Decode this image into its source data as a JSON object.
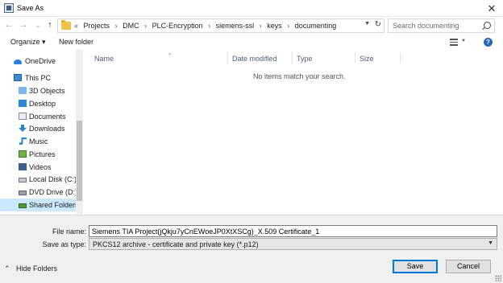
{
  "window": {
    "title": "Save As",
    "close_glyph": "✕"
  },
  "address": {
    "crumbs_prefix": "«",
    "crumbs": [
      "Projects",
      "DMC",
      "PLC-Encryption",
      "siemens-ssl",
      "keys",
      "documenting"
    ],
    "separator": "›"
  },
  "search": {
    "placeholder": "Search documenting"
  },
  "toolbar": {
    "organize_label": "Organize ▾",
    "new_folder_label": "New folder"
  },
  "nav": {
    "items": [
      {
        "label": "OneDrive",
        "icon": "onedrive-icon"
      },
      {
        "label": "This PC",
        "icon": "computer-icon"
      },
      {
        "label": "3D Objects",
        "icon": "3d-objects-icon"
      },
      {
        "label": "Desktop",
        "icon": "desktop-icon"
      },
      {
        "label": "Documents",
        "icon": "documents-icon"
      },
      {
        "label": "Downloads",
        "icon": "downloads-icon"
      },
      {
        "label": "Music",
        "icon": "music-icon"
      },
      {
        "label": "Pictures",
        "icon": "pictures-icon"
      },
      {
        "label": "Videos",
        "icon": "videos-icon"
      },
      {
        "label": "Local Disk (C:)",
        "icon": "local-disk-icon"
      },
      {
        "label": "DVD Drive (D:) C",
        "icon": "dvd-drive-icon"
      },
      {
        "label": "Shared Folders (\\",
        "icon": "shared-folder-icon",
        "selected": true
      }
    ]
  },
  "filelist": {
    "columns": [
      "Name",
      "Date modified",
      "Type",
      "Size"
    ],
    "empty_message": "No items match your search."
  },
  "form": {
    "file_name_label": "File name:",
    "file_name_value": "Siemens TIA Project(jQkju7yCnEWoeJP0XtXSCg)_X.509 Certificate_1",
    "save_as_type_label": "Save as type:",
    "save_as_type_value": "PKCS12 archive - certificate and private key (*.p12)"
  },
  "footer": {
    "hide_folders_label": "Hide Folders",
    "save_label": "Save",
    "cancel_label": "Cancel"
  },
  "colors": {
    "accent": "#0078d7",
    "selection": "#cce8ff"
  }
}
